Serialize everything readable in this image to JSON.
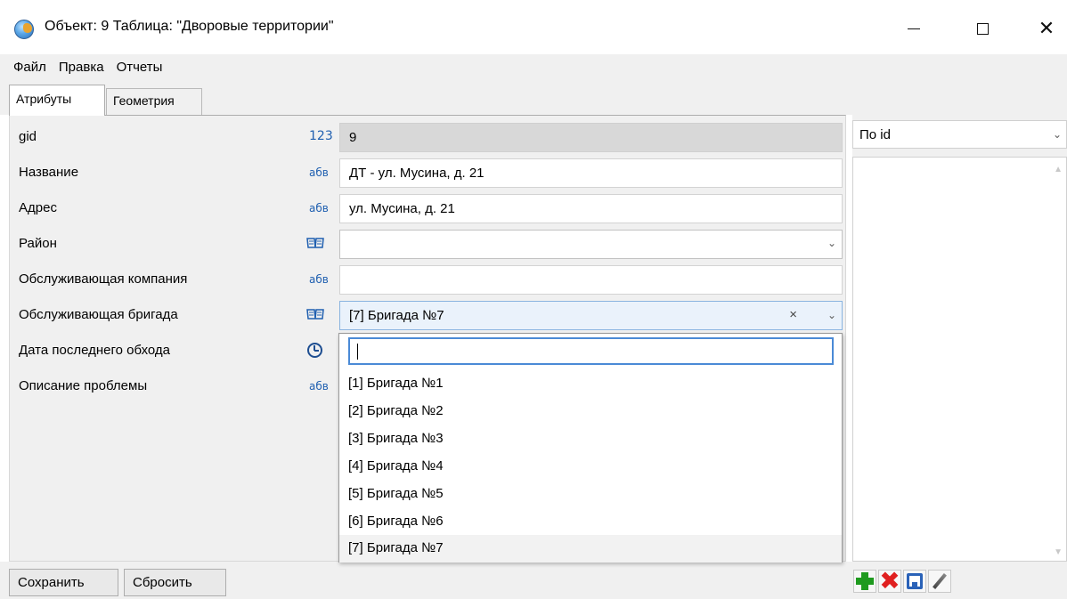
{
  "window": {
    "title": "Объект: 9 Таблица: \"Дворовые территории\"",
    "controls": {
      "minimize": "—",
      "maximize": "☐",
      "close": "✕"
    }
  },
  "menu": [
    "Файл",
    "Правка",
    "Отчеты"
  ],
  "tabs": [
    {
      "label": "Атрибуты",
      "active": true
    },
    {
      "label": "Геометрия",
      "active": false
    }
  ],
  "fields": [
    {
      "label": "gid",
      "type_icon": "123",
      "value": "9",
      "readonly": true
    },
    {
      "label": "Название",
      "type_icon": "абв",
      "value": "ДТ - ул. Мусина, д. 21"
    },
    {
      "label": "Адрес",
      "type_icon": "абв",
      "value": "ул. Мусина, д. 21"
    },
    {
      "label": "Район",
      "type_icon": "book-icon",
      "value": ""
    },
    {
      "label": "Обслуживающая компания",
      "type_icon": "абв",
      "value": ""
    },
    {
      "label": "Обслуживающая бригада",
      "type_icon": "book-icon",
      "value": "[7] Бригада №7"
    },
    {
      "label": "Дата последнего обхода",
      "type_icon": "clock-icon",
      "value": ""
    },
    {
      "label": "Описание проблемы",
      "type_icon": "абв",
      "value": ""
    }
  ],
  "dropdown": {
    "search_value": "",
    "options": [
      "[1] Бригада №1",
      "[2] Бригада №2",
      "[3] Бригада №3",
      "[4] Бригада №4",
      "[5] Бригада №5",
      "[6] Бригада №6",
      "[7] Бригада №7"
    ],
    "selected_index": 6,
    "clear_label": "×",
    "chevron": "⌄"
  },
  "right_panel": {
    "sort_label": "По id"
  },
  "buttons": {
    "save": "Сохранить",
    "reset": "Сбросить"
  },
  "toolbar": {
    "icons": [
      "add-icon",
      "delete-icon",
      "save-icon",
      "edit-icon"
    ],
    "colors": {
      "add": "#1e9a1e",
      "delete": "#e02020",
      "save": "#2a62b8"
    }
  }
}
